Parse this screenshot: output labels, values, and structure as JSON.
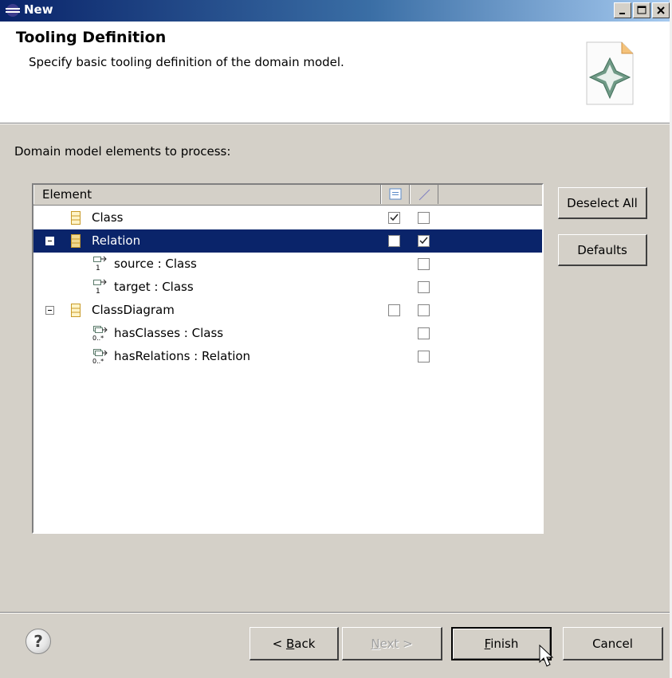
{
  "window": {
    "title": "New"
  },
  "banner": {
    "title": "Tooling Definition",
    "description": "Specify basic tooling definition of the domain model."
  },
  "section_label": "Domain model elements to process:",
  "table": {
    "column_element": "Element",
    "column_node_icon": "node-icon",
    "column_link_icon": "link-icon",
    "rows": [
      {
        "label": "Class",
        "icon": "class-icon",
        "node_checked": true,
        "link_checked": false,
        "selected": false,
        "expandable": false
      },
      {
        "label": "Relation",
        "icon": "class-icon",
        "node_checked": false,
        "link_checked": true,
        "selected": true,
        "expandable": true
      },
      {
        "label": "source : Class",
        "icon": "reference-single-icon",
        "multiplicity": "1",
        "link_checked": false,
        "selected": false
      },
      {
        "label": "target : Class",
        "icon": "reference-single-icon",
        "multiplicity": "1",
        "link_checked": false,
        "selected": false
      },
      {
        "label": "ClassDiagram",
        "icon": "class-icon",
        "node_checked": false,
        "link_checked": false,
        "selected": false,
        "expandable": true
      },
      {
        "label": "hasClasses : Class",
        "icon": "reference-many-icon",
        "multiplicity": "0..*",
        "link_checked": false,
        "selected": false
      },
      {
        "label": "hasRelations : Relation",
        "icon": "reference-many-icon",
        "multiplicity": "0..*",
        "link_checked": false,
        "selected": false
      }
    ]
  },
  "side_buttons": {
    "deselect_all": "Deselect All",
    "defaults": "Defaults"
  },
  "footer": {
    "help": "?",
    "back_prefix": "< ",
    "back_mnemonic": "B",
    "back_rest": "ack",
    "next_mnemonic": "N",
    "next_rest": "ext >",
    "finish_mnemonic": "F",
    "finish_rest": "inish",
    "cancel": "Cancel"
  },
  "colors": {
    "selection": "#0a246a",
    "dialog_bg": "#d4d0c8",
    "title_gradient_start": "#0a246a"
  }
}
